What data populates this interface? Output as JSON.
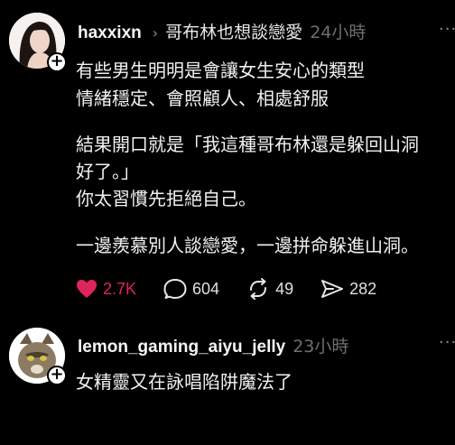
{
  "post": {
    "username": "haxxixn",
    "chevron": "›",
    "thread_title": "哥布林也想談戀愛",
    "time": "24小時",
    "more": "···",
    "lines": [
      "有些男生明明是會讓女生安心的類型",
      "情緒穩定、會照顧人、相處舒服",
      "結果開口就是「我這種哥布林還是躲回山洞",
      "好了。」",
      "你太習慣先拒絕自己。",
      "一邊羨慕別人談戀愛，一邊拼命躲進山洞。"
    ],
    "actions": {
      "likes": "2.7K",
      "comments": "604",
      "reposts": "49",
      "shares": "282"
    },
    "colors": {
      "like": "#e0245e"
    },
    "icons": [
      "heart-icon",
      "comment-icon",
      "repost-icon",
      "share-icon"
    ]
  },
  "reply": {
    "username": "lemon_gaming_aiyu_jelly",
    "time": "23小時",
    "more": "···",
    "text": "女精靈又在詠唱陷阱魔法了"
  },
  "follow_symbol": "+"
}
